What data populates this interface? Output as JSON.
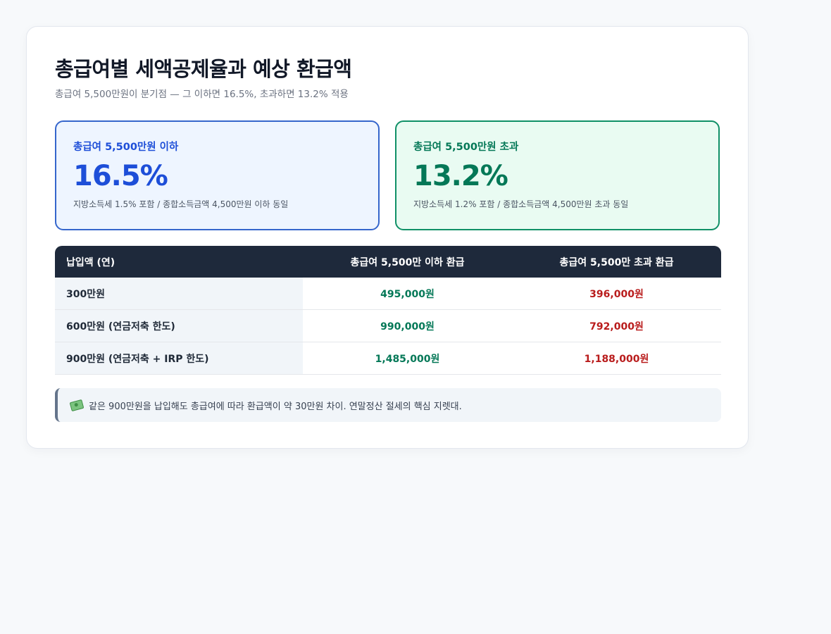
{
  "header": {
    "title": "총급여별 세액공제율과 예상 환급액",
    "subtitle": "총급여 5,500만원이 분기점 — 그 이하면 16.5%, 초과하면 13.2% 적용"
  },
  "rates": [
    {
      "label": "총급여 5,500만원 이하",
      "value": "16.5%",
      "note": "지방소득세 1.5% 포함 / 종합소득금액 4,500만원 이하 동일",
      "color": "#1d4ed8"
    },
    {
      "label": "총급여 5,500만원 초과",
      "value": "13.2%",
      "note": "지방소득세 1.2% 포함 / 종합소득금액 4,500만원 초과 동일",
      "color": "#047857"
    }
  ],
  "table": {
    "headers": [
      "납입액 (연)",
      "총급여 5,500만 이하 환급",
      "총급여 5,500만 초과 환급"
    ],
    "rows": [
      [
        "300만원",
        "495,000원",
        "396,000원"
      ],
      [
        "600만원 (연금저축 한도)",
        "990,000원",
        "792,000원"
      ],
      [
        "900만원 (연금저축 + IRP 한도)",
        "1,485,000원",
        "1,188,000원"
      ]
    ]
  },
  "tip": {
    "icon": "money-with-wings-icon",
    "text": "같은 900만원을 납입해도 총급여에 따라 환급액이 약 30만원 차이. 연말정산 절세의 핵심 지렛대."
  },
  "colors": {
    "low_accent": "#1d4ed8",
    "high_accent": "#047857",
    "high_refund": "#b91c1c",
    "table_header_bg": "#1e293b"
  }
}
